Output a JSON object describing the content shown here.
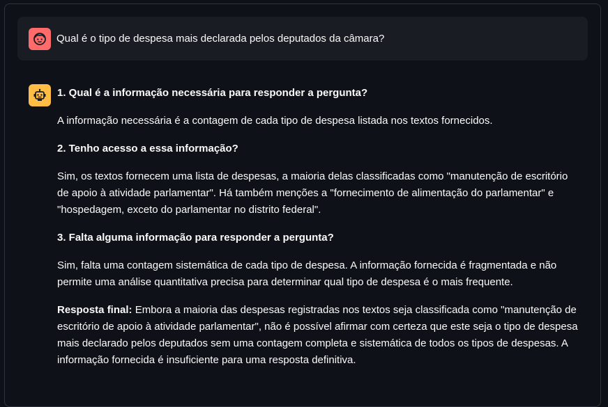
{
  "user_message": {
    "avatar_icon": "user-face-icon",
    "text": "Qual é o tipo de despesa mais declarada pelos deputados da câmara?"
  },
  "assistant_message": {
    "avatar_icon": "robot-icon",
    "heading_1": "1. Qual é a informação necessária para responder a pergunta?",
    "paragraph_1": "A informação necessária é a contagem de cada tipo de despesa listada nos textos fornecidos.",
    "heading_2": "2. Tenho acesso a essa informação?",
    "paragraph_2": "Sim, os textos fornecem uma lista de despesas, a maioria delas classificadas como \"manutenção de escritório de apoio à atividade parlamentar\". Há também menções a \"fornecimento de alimentação do parlamentar\" e \"hospedagem, exceto do parlamentar no distrito federal\".",
    "heading_3": "3. Falta alguma informação para responder a pergunta?",
    "paragraph_3": "Sim, falta uma contagem sistemática de cada tipo de despesa. A informação fornecida é fragmentada e não permite uma análise quantitativa precisa para determinar qual tipo de despesa é o mais frequente.",
    "final_label": "Resposta final:",
    "final_text": " Embora a maioria das despesas registradas nos textos seja classificada como \"manutenção de escritório de apoio à atividade parlamentar\", não é possível afirmar com certeza que este seja o tipo de despesa mais declarado pelos deputados sem uma contagem completa e sistemática de todos os tipos de despesas. A informação fornecida é insuficiente para uma resposta definitiva."
  },
  "colors": {
    "background": "#0e1117",
    "user_bubble": "#1a1c24",
    "user_avatar": "#ff6b6b",
    "bot_avatar": "#ffbd45",
    "text": "#fafafa"
  }
}
